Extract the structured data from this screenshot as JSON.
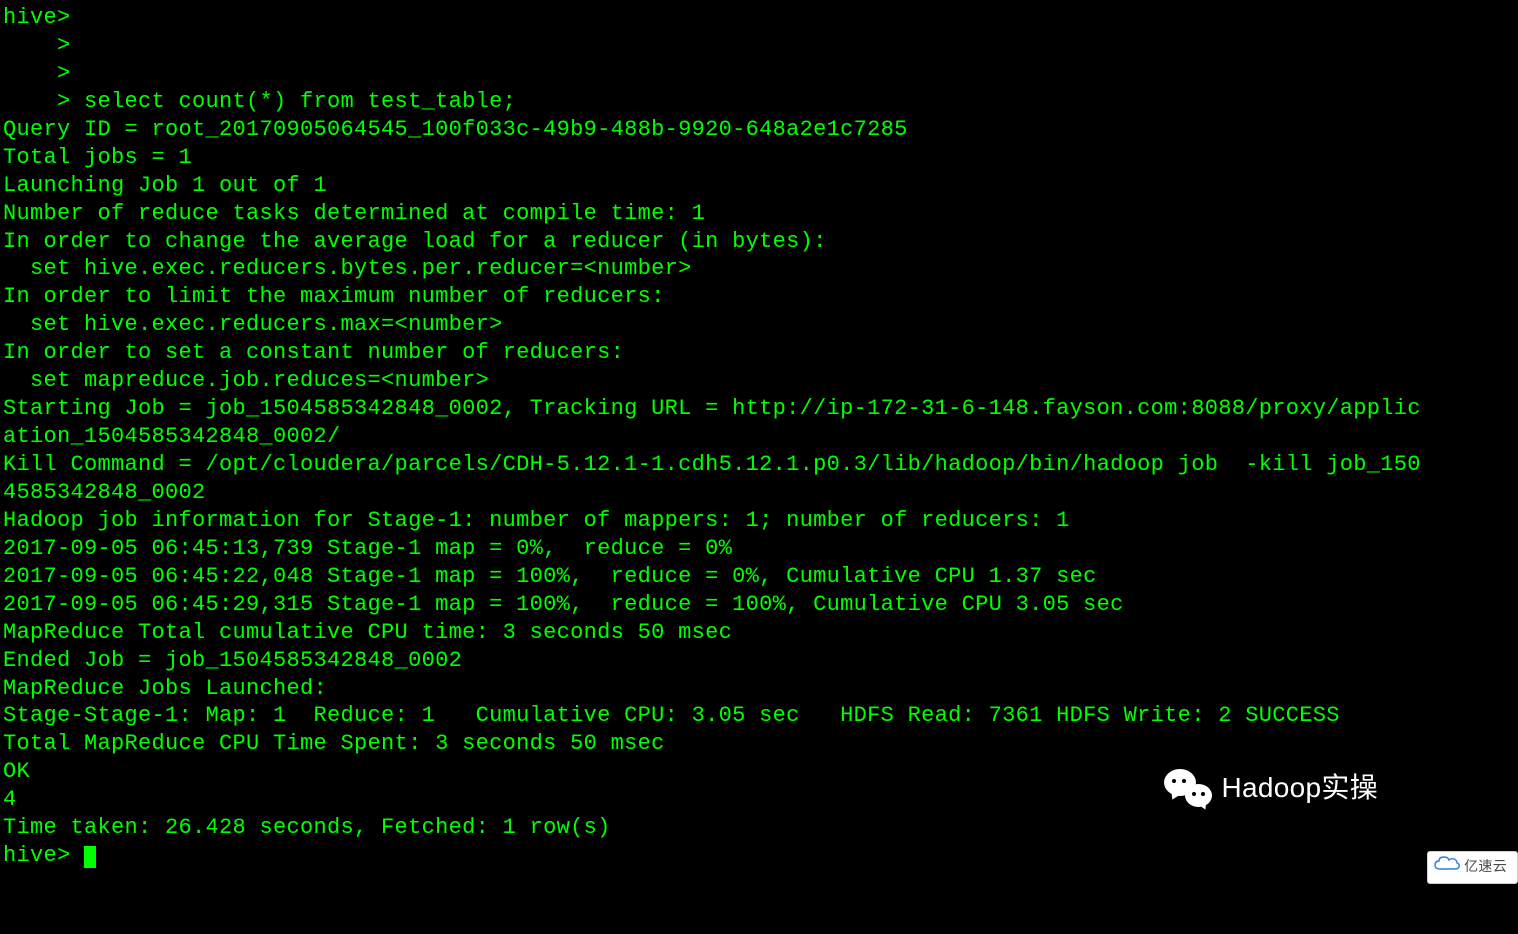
{
  "terminal": {
    "lines": [
      "hive>",
      "    >",
      "    >",
      "    > select count(*) from test_table;",
      "Query ID = root_20170905064545_100f033c-49b9-488b-9920-648a2e1c7285",
      "Total jobs = 1",
      "Launching Job 1 out of 1",
      "Number of reduce tasks determined at compile time: 1",
      "In order to change the average load for a reducer (in bytes):",
      "  set hive.exec.reducers.bytes.per.reducer=<number>",
      "In order to limit the maximum number of reducers:",
      "  set hive.exec.reducers.max=<number>",
      "In order to set a constant number of reducers:",
      "  set mapreduce.job.reduces=<number>",
      "Starting Job = job_1504585342848_0002, Tracking URL = http://ip-172-31-6-148.fayson.com:8088/proxy/applic",
      "ation_1504585342848_0002/",
      "Kill Command = /opt/cloudera/parcels/CDH-5.12.1-1.cdh5.12.1.p0.3/lib/hadoop/bin/hadoop job  -kill job_150",
      "4585342848_0002",
      "Hadoop job information for Stage-1: number of mappers: 1; number of reducers: 1",
      "2017-09-05 06:45:13,739 Stage-1 map = 0%,  reduce = 0%",
      "2017-09-05 06:45:22,048 Stage-1 map = 100%,  reduce = 0%, Cumulative CPU 1.37 sec",
      "2017-09-05 06:45:29,315 Stage-1 map = 100%,  reduce = 100%, Cumulative CPU 3.05 sec",
      "MapReduce Total cumulative CPU time: 3 seconds 50 msec",
      "Ended Job = job_1504585342848_0002",
      "MapReduce Jobs Launched:",
      "Stage-Stage-1: Map: 1  Reduce: 1   Cumulative CPU: 3.05 sec   HDFS Read: 7361 HDFS Write: 2 SUCCESS",
      "Total MapReduce CPU Time Spent: 3 seconds 50 msec",
      "OK",
      "4",
      "Time taken: 26.428 seconds, Fetched: 1 row(s)"
    ],
    "prompt": "hive> "
  },
  "watermark": {
    "wechat_label": "Hadoop实操",
    "yisu_label": "亿速云"
  }
}
